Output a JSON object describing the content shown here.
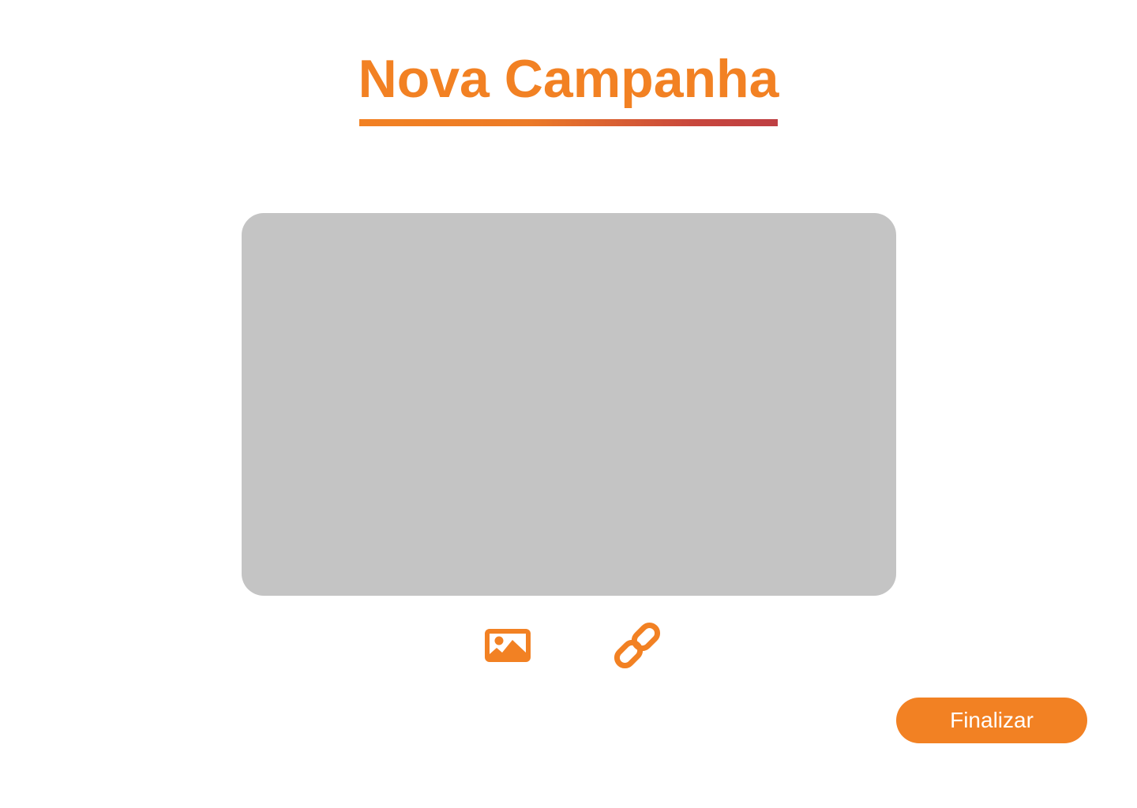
{
  "page": {
    "title": "Nova Campanha"
  },
  "media": {
    "image_icon": "image-icon",
    "link_icon": "link-icon"
  },
  "actions": {
    "finish_label": "Finalizar"
  },
  "colors": {
    "accent": "#F28123",
    "gradient_end": "#BE3F43",
    "placeholder": "#C4C4C4",
    "button_text": "#FFFFFF"
  }
}
